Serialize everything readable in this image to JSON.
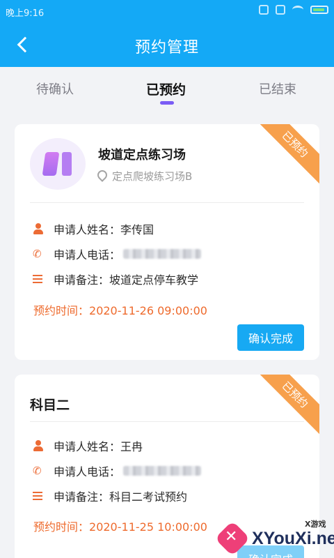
{
  "status_bar": {
    "time": "晚上9:16"
  },
  "header": {
    "title": "预约管理"
  },
  "tabs": [
    {
      "label": "待确认"
    },
    {
      "label": "已预约"
    },
    {
      "label": "已结束"
    }
  ],
  "cards": [
    {
      "ribbon": "已预约",
      "place_name": "坡道定点练习场",
      "place_address": "定点爬坡练习场B",
      "applicant_name_label": "申请人姓名：",
      "applicant_name": "李传国",
      "applicant_phone_label": "申请人电话：",
      "remark_label": "申请备注：",
      "remark": "坡道定点停车教学",
      "time_label": "预约时间：",
      "time_value": "2020-11-26 09:00:00",
      "button": "确认完成"
    },
    {
      "ribbon": "已预约",
      "title": "科目二",
      "applicant_name_label": "申请人姓名：",
      "applicant_name": "王冉",
      "applicant_phone_label": "申请人电话：",
      "remark_label": "申请备注：",
      "remark": "科目二考试预约",
      "time_label": "预约时间：",
      "time_value": "2020-11-25 10:00:00",
      "button": "确认完成"
    }
  ],
  "watermark": {
    "small": "X游戏",
    "text": "XYouXi.net"
  },
  "colors": {
    "primary": "#14a9f6",
    "accent": "#ee6a2c",
    "ribbon": "#f7a04c",
    "tab_indicator": "#7a5cf5"
  }
}
